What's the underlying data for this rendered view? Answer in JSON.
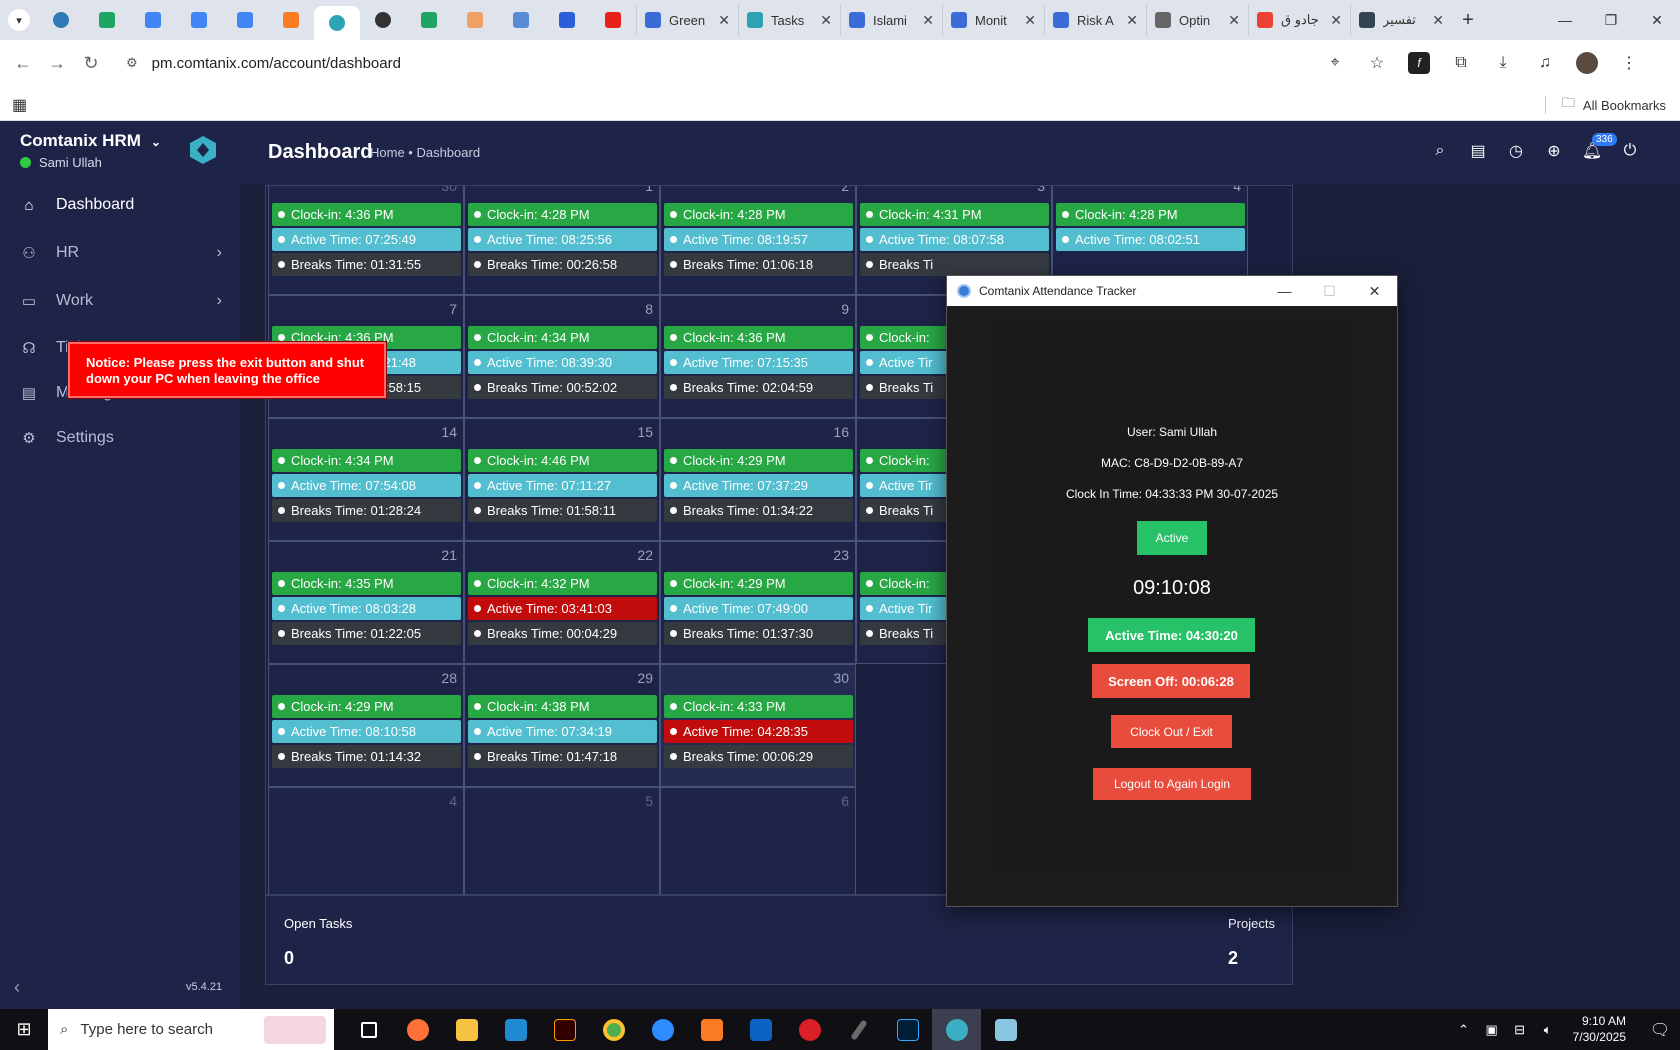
{
  "browser": {
    "tabs": [
      {
        "title": "Green",
        "favicon_color": "#3b6bd6"
      },
      {
        "title": "Tasks",
        "favicon_color": "#2ea3b5"
      },
      {
        "title": "Islami",
        "favicon_color": "#3b6bd6"
      },
      {
        "title": "Monit",
        "favicon_color": "#3b6bd6"
      },
      {
        "title": "Risk A",
        "favicon_color": "#3b6bd6"
      },
      {
        "title": "Optin",
        "favicon_color": "#666666"
      },
      {
        "title": "جادو ق",
        "favicon_color": "#ea4335"
      },
      {
        "title": "تفسير",
        "favicon_color": "#334455"
      }
    ],
    "url": "pm.comtanix.com/account/dashboard",
    "bookmarks_label": "All Bookmarks"
  },
  "app": {
    "brand": "Comtanix HRM",
    "user_name": "Sami Ullah",
    "version": "v5.4.21",
    "menu": [
      {
        "label": "Dashboard",
        "icon": "home-icon"
      },
      {
        "label": "HR",
        "icon": "users-icon"
      },
      {
        "label": "Work",
        "icon": "briefcase-icon"
      },
      {
        "label": "Tickets",
        "icon": "headset-icon"
      },
      {
        "label": "Messages",
        "icon": "message-icon"
      },
      {
        "label": "Settings",
        "icon": "gear-icon"
      }
    ],
    "page_title": "Dashboard",
    "breadcrumb": "Home • Dashboard",
    "notification_count": "336"
  },
  "calendar": {
    "rows": [
      [
        {
          "day": "30",
          "dim": true,
          "clock_in": "Clock-in: 4:36 PM",
          "active": "Active Time: 07:25:49",
          "breaks": "Breaks Time: 01:31:55"
        },
        {
          "day": "1",
          "clock_in": "Clock-in: 4:28 PM",
          "active": "Active Time: 08:25:56",
          "breaks": "Breaks Time: 00:26:58"
        },
        {
          "day": "2",
          "clock_in": "Clock-in: 4:28 PM",
          "active": "Active Time: 08:19:57",
          "breaks": "Breaks Time: 01:06:18"
        },
        {
          "day": "3",
          "clock_in": "Clock-in: 4:31 PM",
          "active": "Active Time: 08:07:58",
          "breaks": "Breaks Ti"
        },
        {
          "day": "4",
          "clock_in": "Clock-in: 4:28 PM",
          "active": "Active Time: 08:02:51",
          "breaks": ""
        }
      ],
      [
        {
          "day": "7",
          "clock_in": "Clock-in: 4:36 PM",
          "active": "Active Time: 08:21:48",
          "breaks": "Breaks Time: 00:58:15"
        },
        {
          "day": "8",
          "clock_in": "Clock-in: 4:34 PM",
          "active": "Active Time: 08:39:30",
          "breaks": "Breaks Time: 00:52:02"
        },
        {
          "day": "9",
          "clock_in": "Clock-in: 4:36 PM",
          "active": "Active Time: 07:15:35",
          "breaks": "Breaks Time: 02:04:59"
        },
        {
          "day": "",
          "clock_in": "Clock-in:",
          "active": "Active Tir",
          "breaks": "Breaks Ti"
        }
      ],
      [
        {
          "day": "14",
          "clock_in": "Clock-in: 4:34 PM",
          "active": "Active Time: 07:54:08",
          "breaks": "Breaks Time: 01:28:24"
        },
        {
          "day": "15",
          "clock_in": "Clock-in: 4:46 PM",
          "active": "Active Time: 07:11:27",
          "breaks": "Breaks Time: 01:58:11"
        },
        {
          "day": "16",
          "clock_in": "Clock-in: 4:29 PM",
          "active": "Active Time: 07:37:29",
          "breaks": "Breaks Time: 01:34:22"
        },
        {
          "day": "",
          "clock_in": "Clock-in:",
          "active": "Active Tir",
          "breaks": "Breaks Ti"
        }
      ],
      [
        {
          "day": "21",
          "clock_in": "Clock-in: 4:35 PM",
          "active": "Active Time: 08:03:28",
          "breaks": "Breaks Time: 01:22:05"
        },
        {
          "day": "22",
          "clock_in": "Clock-in: 4:32 PM",
          "active": "Active Time: 03:41:03",
          "low": true,
          "breaks": "Breaks Time: 00:04:29"
        },
        {
          "day": "23",
          "clock_in": "Clock-in: 4:29 PM",
          "active": "Active Time: 07:49:00",
          "breaks": "Breaks Time: 01:37:30"
        },
        {
          "day": "",
          "clock_in": "Clock-in:",
          "active": "Active Tir",
          "breaks": "Breaks Ti"
        }
      ],
      [
        {
          "day": "28",
          "clock_in": "Clock-in: 4:29 PM",
          "active": "Active Time: 08:10:58",
          "breaks": "Breaks Time: 01:14:32"
        },
        {
          "day": "29",
          "clock_in": "Clock-in: 4:38 PM",
          "active": "Active Time: 07:34:19",
          "breaks": "Breaks Time: 01:47:18"
        },
        {
          "day": "30",
          "today": true,
          "clock_in": "Clock-in: 4:33 PM",
          "active": "Active Time: 04:28:35",
          "low": true,
          "breaks": "Breaks Time: 00:06:29"
        }
      ],
      [
        {
          "day": "4",
          "dim": true
        },
        {
          "day": "5",
          "dim": true
        },
        {
          "day": "6",
          "dim": true
        }
      ]
    ]
  },
  "stats": {
    "open_tasks_label": "Open Tasks",
    "open_tasks_value": "0",
    "projects_label": "Projects",
    "projects_value": "2"
  },
  "tracker": {
    "title": "Comtanix Attendance Tracker",
    "notice": "Notice: Please press the exit button and shut down your PC when leaving the office",
    "user": "User: Sami Ullah",
    "mac": "MAC: C8-D9-D2-0B-89-A7",
    "clock_in": "Clock In Time: 04:33:33 PM 30-07-2025",
    "status": "Active",
    "clock": "09:10:08",
    "active_time": "Active Time: 04:30:20",
    "screen_off": "Screen Off: 00:06:28",
    "clock_out_label": "Clock Out / Exit",
    "logout_label": "Logout to Again Login"
  },
  "taskbar": {
    "search_placeholder": "Type here to search",
    "time": "9:10 AM",
    "date": "7/30/2025"
  }
}
